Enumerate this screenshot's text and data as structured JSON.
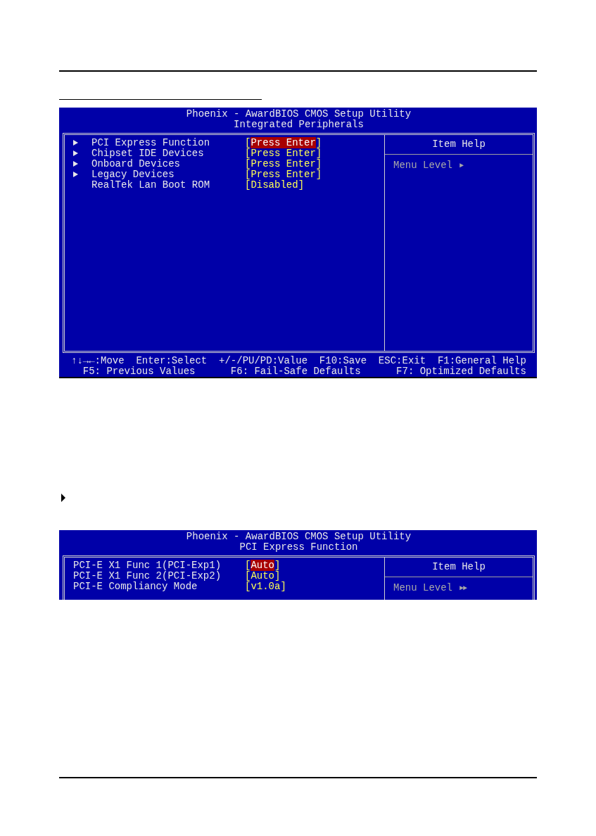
{
  "screens": [
    {
      "title": "Phoenix - AwardBIOS CMOS Setup Utility",
      "subtitle": "Integrated Peripherals",
      "cut": false,
      "items": [
        {
          "label": "PCI Express Function",
          "value": "[Press Enter]",
          "submenu": true,
          "selected": true
        },
        {
          "label": "Chipset IDE Devices",
          "value": "[Press Enter]",
          "submenu": true,
          "selected": false
        },
        {
          "label": "Onboard Devices",
          "value": "[Press Enter]",
          "submenu": true,
          "selected": false
        },
        {
          "label": "Legacy Devices",
          "value": "[Press Enter]",
          "submenu": true,
          "selected": false
        },
        {
          "label": "RealTek Lan Boot ROM",
          "value": "[Disabled]",
          "submenu": false,
          "selected": false
        }
      ],
      "help": {
        "title": "Item Help",
        "menu_level_label": "Menu Level",
        "menu_level": "►"
      },
      "footer": [
        "↑↓→←:Move  Enter:Select  +/-/PU/PD:Value  F10:Save  ESC:Exit  F1:General Help",
        "  F5: Previous Values      F6: Fail-Safe Defaults      F7: Optimized Defaults"
      ]
    },
    {
      "title": "Phoenix - AwardBIOS CMOS Setup Utility",
      "subtitle": "PCI Express Function",
      "cut": true,
      "items": [
        {
          "label": "PCI-E X1 Func 1(PCI-Exp1)",
          "value": "[Auto]",
          "submenu": false,
          "selected": true
        },
        {
          "label": "PCI-E X1 Func 2(PCI-Exp2)",
          "value": "[Auto]",
          "submenu": false,
          "selected": false
        },
        {
          "label": "PCI-E Compliancy Mode",
          "value": "[v1.0a]",
          "submenu": false,
          "selected": false
        }
      ],
      "help": {
        "title": "Item Help",
        "menu_level_label": "Menu Level",
        "menu_level": "►►"
      }
    }
  ]
}
